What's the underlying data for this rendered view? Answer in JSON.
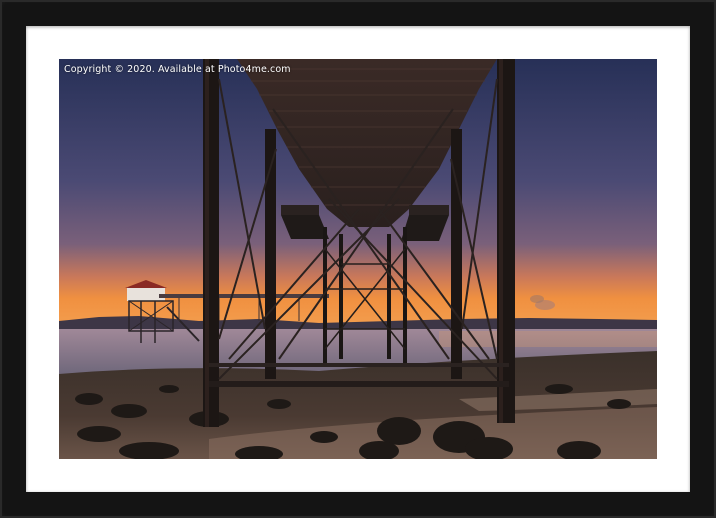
{
  "product": "Framed Mounted Print",
  "watermark": {
    "text": "Copyright ©   2020. Available at Photo4me.com"
  },
  "frame": {
    "frame_color": "#141414",
    "mount_color": "#ffffff"
  },
  "photo": {
    "subject": "pier-underside-at-sunset",
    "palette": {
      "sky_top": "#2c3258",
      "sky_mid": "#5a4a6e",
      "horizon_glow": "#e8853c",
      "water": "#8a8090",
      "beach": "#2a2420",
      "structure": "#1c1816"
    }
  }
}
